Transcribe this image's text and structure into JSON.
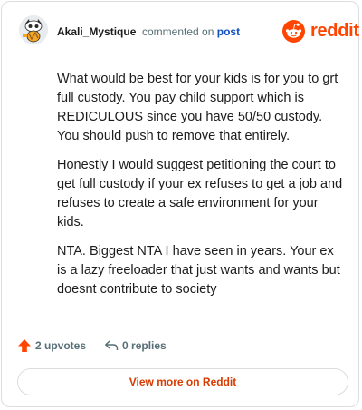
{
  "header": {
    "author": "Akali_Mystique",
    "action_text": "commented on",
    "post_link": "post",
    "logo_word": "reddit"
  },
  "comment": {
    "paragraphs": [
      "What would be best for your kids is for you to grt full custody. You pay child support which is REDICULOUS since you have 50/50 custody. You should push to remove that entirely.",
      "Honestly I would suggest petitioning the court to get full custody if your ex refuses to get a job and refuses to create a safe environment for your kids.",
      "NTA. Biggest NTA I have seen in years. Your ex is a lazy freeloader that just wants and wants but doesnt contribute to society"
    ]
  },
  "footer": {
    "upvotes": "2 upvotes",
    "replies": "0 replies"
  },
  "cta": {
    "label": "View more on Reddit"
  },
  "colors": {
    "brand": "#ff4500",
    "link": "#0e4fbf",
    "cta": "#d93a00"
  }
}
